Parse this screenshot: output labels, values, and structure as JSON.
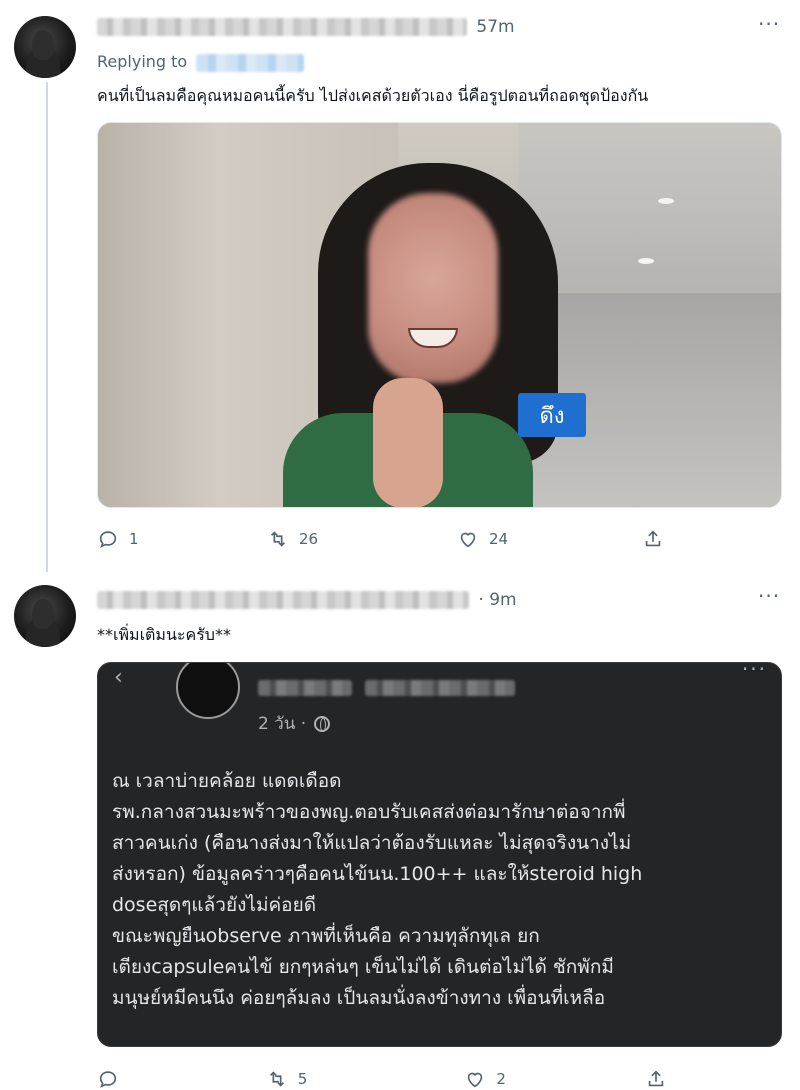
{
  "tweet1": {
    "time": "57m",
    "replying_to_label": "Replying to",
    "text": "คนที่เป็นลมคือคุณหมอคนนี้ครับ ไปส่งเคสด้วยตัวเอง นี่คือรูปตอนที่ถอดชุดป้องกัน",
    "more": "···",
    "photo_sign": "ดึง",
    "actions": {
      "replies": "1",
      "retweets": "26",
      "likes": "24"
    }
  },
  "tweet2": {
    "time": "· 9m",
    "more": "···",
    "text": "**เพิ่มเติมนะครับ**",
    "embed": {
      "back": "‹",
      "dots": "···",
      "time": "2 วัน ·",
      "lines": [
        "ณ เวลาบ่ายคล้อย แดดเดือด",
        "รพ.กลางสวนมะพร้าวของพญ.ตอบรับเคสส่งต่อมารักษาต่อจากพี่",
        "สาวคนเก่ง (คือนางส่งมาให้แปลว่าต้องรับแหละ ไม่สุดจริงนางไม่",
        "ส่งหรอก) ข้อมูลคร่าวๆคือคนไข้นน.100++ และให้steroid high",
        "doseสุดๆแล้วยังไม่ค่อยดี",
        "ขณะพญยืนobserve ภาพที่เห็นคือ ความทุลักทุเล ยก",
        "เตียงcapsuleคนไข้ ยกๆหล่นๆ เข็นไม่ได้ เดินต่อไม่ได้ ชักพักมี",
        "มนุษย์หมีคนนึง ค่อยๆล้มลง เป็นลมนั่งลงข้างทาง เพื่อนที่เหลือ",
        "                                                          "
      ]
    },
    "actions": {
      "replies": "",
      "retweets": "5",
      "likes": "2"
    }
  },
  "icons": [
    "reply-icon",
    "retweet-icon",
    "like-icon",
    "share-icon",
    "globe-icon"
  ]
}
